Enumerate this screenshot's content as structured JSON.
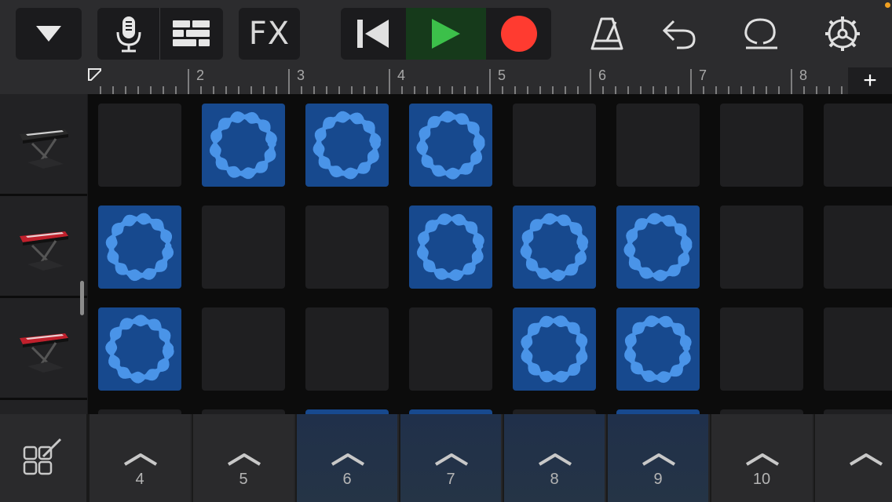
{
  "toolbar": {
    "fx_label": "FX",
    "buttons": {
      "tracks_menu": "chevron-down-icon",
      "record_input": "microphone-icon",
      "view_toggle": "tracks-view-icon",
      "rewind": "skip-back-icon",
      "play": "play-icon",
      "record": "record-icon",
      "metronome": "metronome-icon",
      "undo": "undo-icon",
      "loops": "loop-icon",
      "settings": "gear-icon"
    },
    "colors": {
      "play_bg": "#163a1b",
      "play_icon": "#3cc04a",
      "record": "#ff3b30"
    }
  },
  "ruler": {
    "bars": [
      "2",
      "3",
      "4",
      "5",
      "6",
      "7",
      "8"
    ],
    "add_label": "+"
  },
  "tracks": [
    {
      "name": "keyboard-track-1",
      "instrument_color": "#2a2a2a"
    },
    {
      "name": "keyboard-track-2",
      "instrument_color": "#c0202c"
    },
    {
      "name": "keyboard-track-3",
      "instrument_color": "#c0202c"
    }
  ],
  "grid": {
    "rows": [
      [
        0,
        1,
        1,
        1,
        0,
        0,
        0,
        0
      ],
      [
        1,
        0,
        0,
        1,
        1,
        1,
        0,
        0
      ],
      [
        1,
        0,
        0,
        0,
        1,
        1,
        0,
        0
      ]
    ],
    "partial_row": [
      0,
      0,
      1,
      1,
      0,
      1,
      0,
      0
    ],
    "colors": {
      "active": "#17498e",
      "waveform": "#4a94e8",
      "empty": "#1f1f21"
    }
  },
  "bottom": {
    "edit_button": "edit-cells-icon",
    "triggers": [
      {
        "label": "4",
        "active": false
      },
      {
        "label": "5",
        "active": false
      },
      {
        "label": "6",
        "active": true
      },
      {
        "label": "7",
        "active": true
      },
      {
        "label": "8",
        "active": true
      },
      {
        "label": "9",
        "active": true
      },
      {
        "label": "10",
        "active": false
      },
      {
        "label": "",
        "active": false
      }
    ]
  }
}
